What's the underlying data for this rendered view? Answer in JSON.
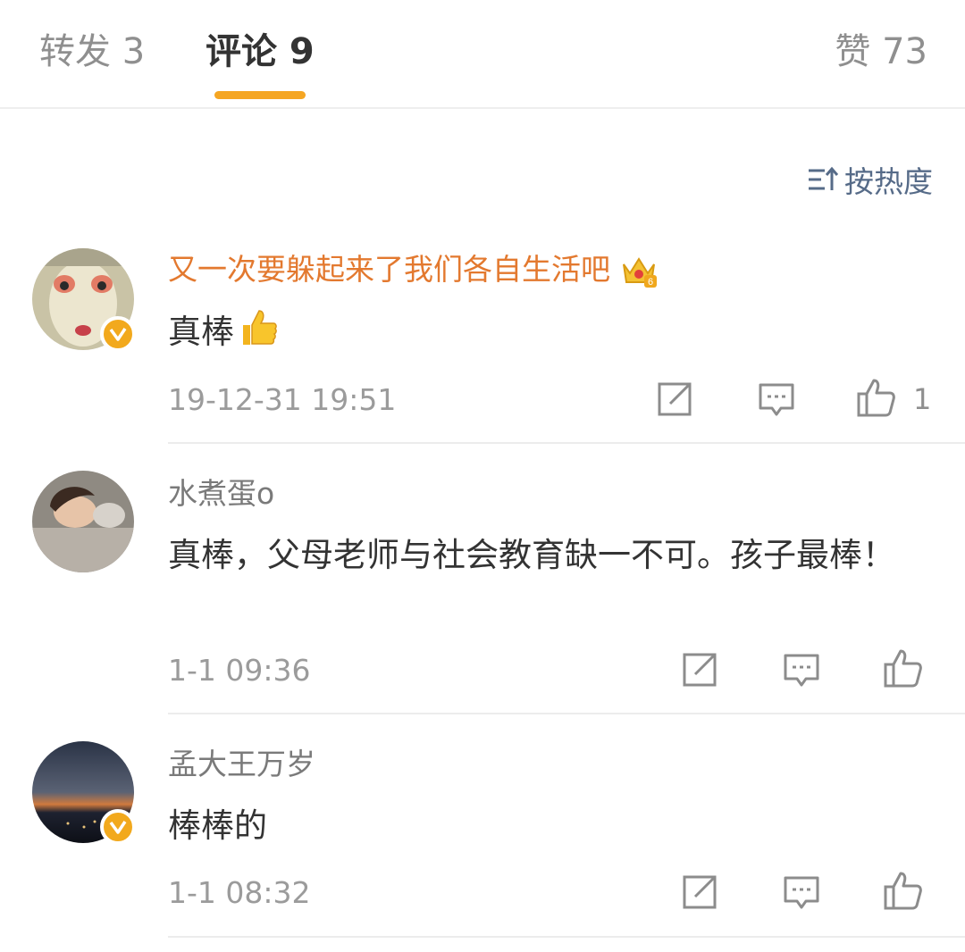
{
  "tabs": {
    "repost": "转发 3",
    "comments": "评论 9",
    "likes": "赞 73"
  },
  "sort": {
    "label": "按热度",
    "icon": "sort-by-heat-icon"
  },
  "comments": [
    {
      "author": "又一次要躲起来了我们各自生活吧",
      "author_style": "vip",
      "verified": true,
      "badge": "crown-level-badge-icon",
      "text": "真棒",
      "emoji": "thumbs-up-emoji",
      "time": "19-12-31 19:51",
      "like_count": "1"
    },
    {
      "author": "水煮蛋o",
      "author_style": "plain",
      "verified": false,
      "text": "真棒，父母老师与社会教育缺一不可。孩子最棒！",
      "time": "1-1 09:36",
      "like_count": ""
    },
    {
      "author": "孟大王万岁",
      "author_style": "plain",
      "verified": true,
      "text": "棒棒的",
      "time": "1-1 08:32",
      "like_count": ""
    }
  ],
  "colors": {
    "accent": "#f5a623",
    "vip_name": "#e3792f",
    "sort_link": "#566b88",
    "verified_badge": "#f2a91d"
  }
}
